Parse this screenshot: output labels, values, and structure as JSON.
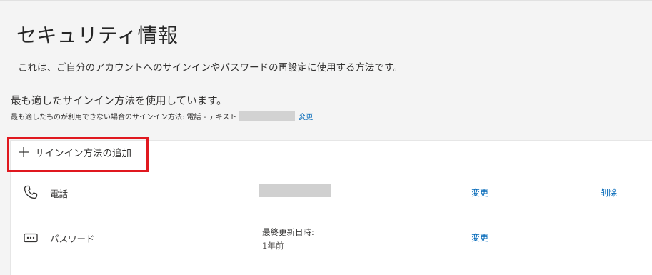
{
  "header": {
    "title": "セキュリティ情報",
    "description": "これは、ご自分のアカウントへのサインインやパスワードの再設定に使用する方法です。"
  },
  "default_method": {
    "heading": "最も適したサインイン方法を使用しています。",
    "fallback_prefix": "最も適したものが利用できない場合のサインイン方法: 電話 - テキスト",
    "change_label": "変更"
  },
  "add_method": {
    "label": "サインイン方法の追加",
    "icon": "plus-icon",
    "highlight_color": "#e0181f"
  },
  "methods": [
    {
      "name": "電話",
      "icon": "phone-icon",
      "change_label": "変更",
      "delete_label": "削除"
    },
    {
      "name": "パスワード",
      "icon": "password-dots-icon",
      "last_updated_label": "最終更新日時:",
      "last_updated_value": "1年前",
      "change_label": "変更"
    }
  ],
  "colors": {
    "link": "#0067b8",
    "background": "#f4f4f4",
    "card": "#ffffff",
    "redacted": "#d0d0d0"
  }
}
